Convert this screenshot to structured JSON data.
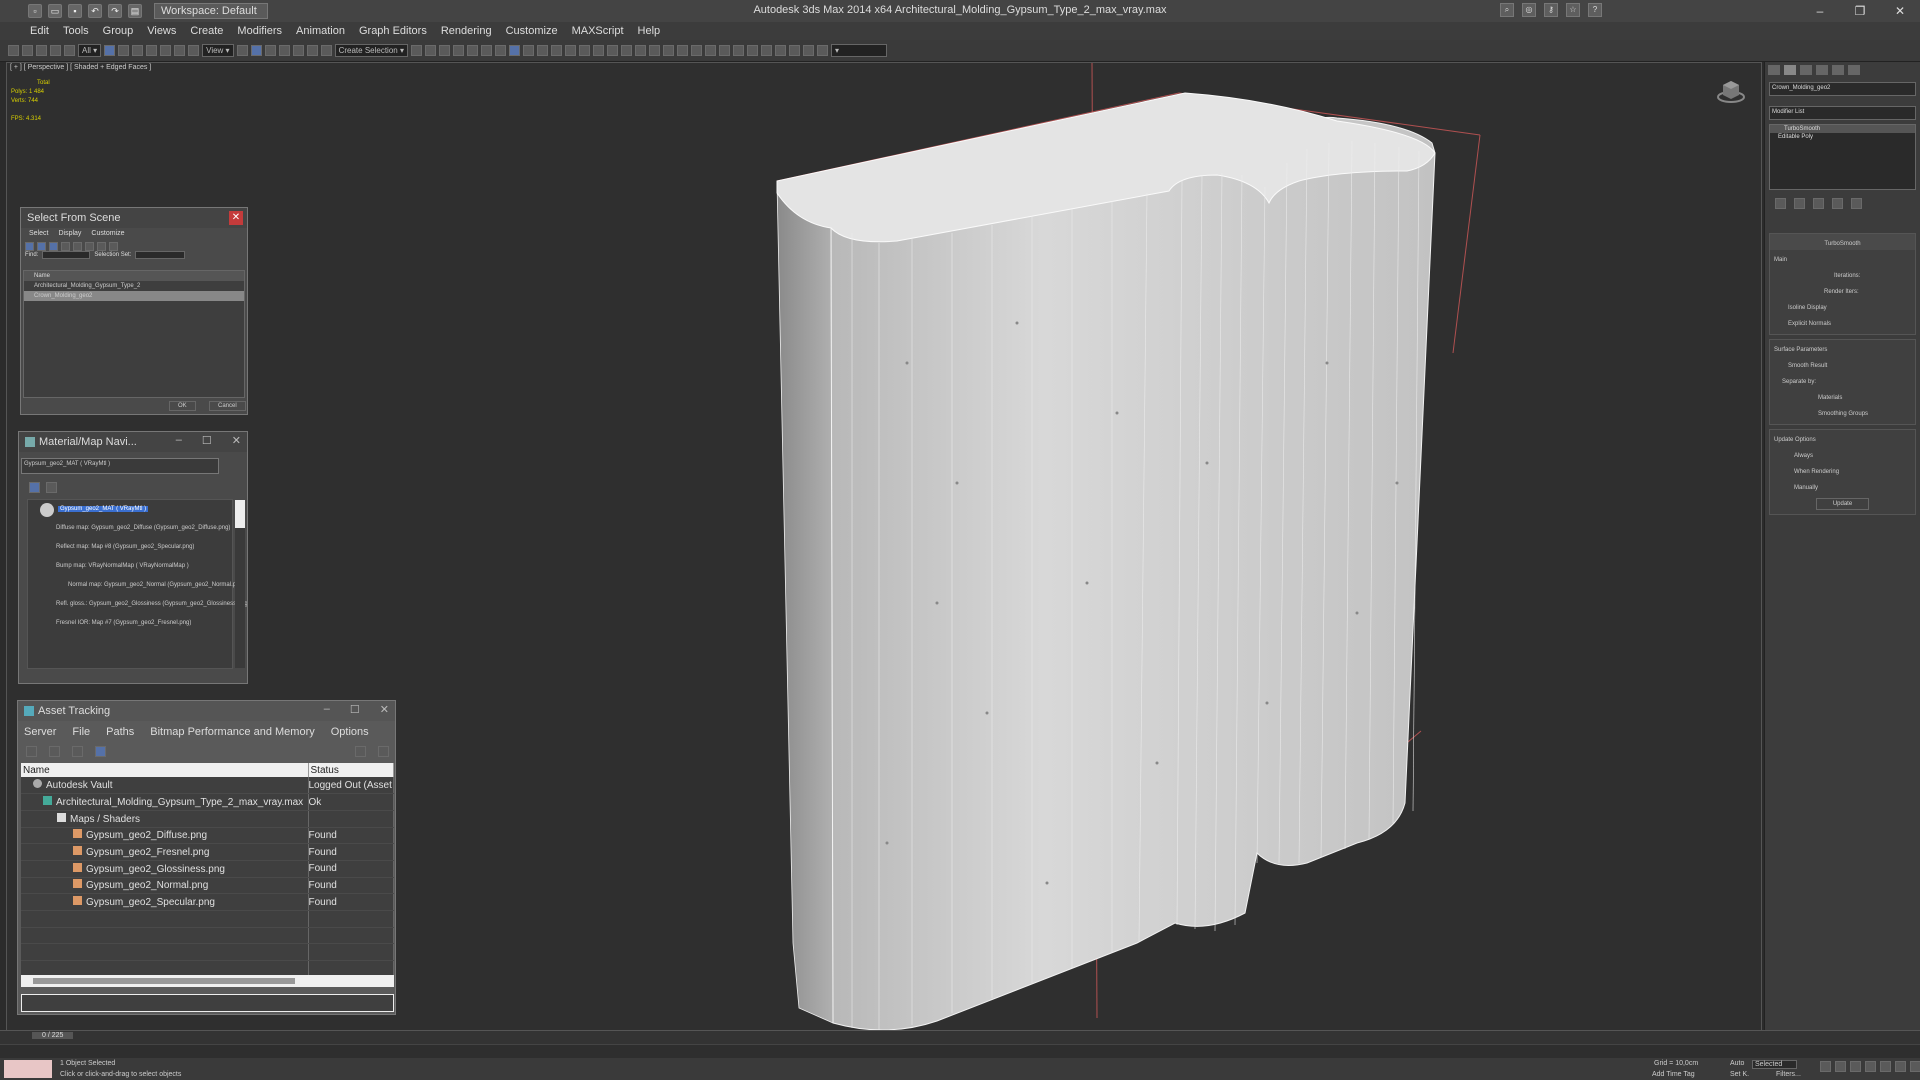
{
  "title_bar": {
    "workspace": "Workspace: Default",
    "app_title": "Autodesk 3ds Max  2014 x64     Architectural_Molding_Gypsum_Type_2_max_vray.max"
  },
  "menu": [
    "Edit",
    "Tools",
    "Group",
    "Views",
    "Create",
    "Modifiers",
    "Animation",
    "Graph Editors",
    "Rendering",
    "Customize",
    "MAXScript",
    "Help"
  ],
  "viewport": {
    "label": "[ + ] [ Perspective ] [ Shaded + Edged Faces ]",
    "stats": {
      "total": "Total",
      "polys": "Polys:  1 484",
      "verts": "Verts:   744",
      "fps": "FPS:     4.314"
    }
  },
  "select_from_scene": {
    "title": "Select From Scene",
    "menu": [
      "Select",
      "Display",
      "Customize"
    ],
    "find_label": "Find:",
    "selection_set_label": "Selection Set:",
    "column": "Name",
    "rows": [
      "Architectural_Molding_Gypsum_Type_2",
      "Crown_Molding_geo2"
    ],
    "ok": "OK",
    "cancel": "Cancel"
  },
  "material_navigator": {
    "title": "Material/Map Navi...",
    "field": "Gypsum_geo2_MAT  ( VRayMtl )",
    "nodes": [
      "Gypsum_geo2_MAT  ( VRayMtl )",
      "Diffuse map: Gypsum_geo2_Diffuse (Gypsum_geo2_Diffuse.png)",
      "Reflect map: Map #8 (Gypsum_geo2_Specular.png)",
      "Bump map: VRayNormalMap  ( VRayNormalMap )",
      "Normal map: Gypsum_geo2_Normal (Gypsum_geo2_Normal.png)",
      "Refl. gloss.: Gypsum_geo2_Glossiness (Gypsum_geo2_Glossiness.png)",
      "Fresnel IOR: Map #7 (Gypsum_geo2_Fresnel.png)"
    ]
  },
  "asset_tracking": {
    "title": "Asset Tracking",
    "menu": [
      "Server",
      "File",
      "Paths",
      "Bitmap Performance and Memory",
      "Options"
    ],
    "columns": [
      "Name",
      "Status"
    ],
    "rows": [
      {
        "name": "Autodesk Vault",
        "status": "Logged Out (Asset"
      },
      {
        "name": "Architectural_Molding_Gypsum_Type_2_max_vray.max",
        "status": "Ok"
      },
      {
        "name": "Maps / Shaders",
        "status": ""
      },
      {
        "name": "Gypsum_geo2_Diffuse.png",
        "status": "Found"
      },
      {
        "name": "Gypsum_geo2_Fresnel.png",
        "status": "Found"
      },
      {
        "name": "Gypsum_geo2_Glossiness.png",
        "status": "Found"
      },
      {
        "name": "Gypsum_geo2_Normal.png",
        "status": "Found"
      },
      {
        "name": "Gypsum_geo2_Specular.png",
        "status": "Found"
      }
    ]
  },
  "command_panel": {
    "object_name": "Crown_Molding_geo2",
    "modifier_list": "Modifier List",
    "stack": [
      "TurboSmooth",
      "Editable Poly"
    ],
    "turbosmooth": {
      "header": "TurboSmooth",
      "main": "Main",
      "iterations": "Iterations:",
      "render_iters": "Render Iters:",
      "isoline": "Isoline Display",
      "explicit": "Explicit Normals",
      "surface": "Surface Parameters",
      "smooth_result": "Smooth Result",
      "separate_by": "Separate by:",
      "materials": "Materials",
      "smoothing_groups": "Smoothing Groups",
      "update_options": "Update Options",
      "always": "Always",
      "when_rendering": "When Rendering",
      "manually": "Manually",
      "update": "Update"
    }
  },
  "timeline": {
    "frame": "0 / 225"
  },
  "status": {
    "selected": "1 Object Selected",
    "prompt": "Click or click-and-drag to select objects",
    "grid": "Grid = 10,0cm",
    "auto": "Auto",
    "selected_dd": "Selected",
    "set_key": "Set K.",
    "filters": "Filters...",
    "add_time_tag": "Add Time Tag"
  },
  "colors": {
    "accent": "#5571a8",
    "viewport_bg": "#2f2f2f",
    "close": "#c43b3b"
  }
}
